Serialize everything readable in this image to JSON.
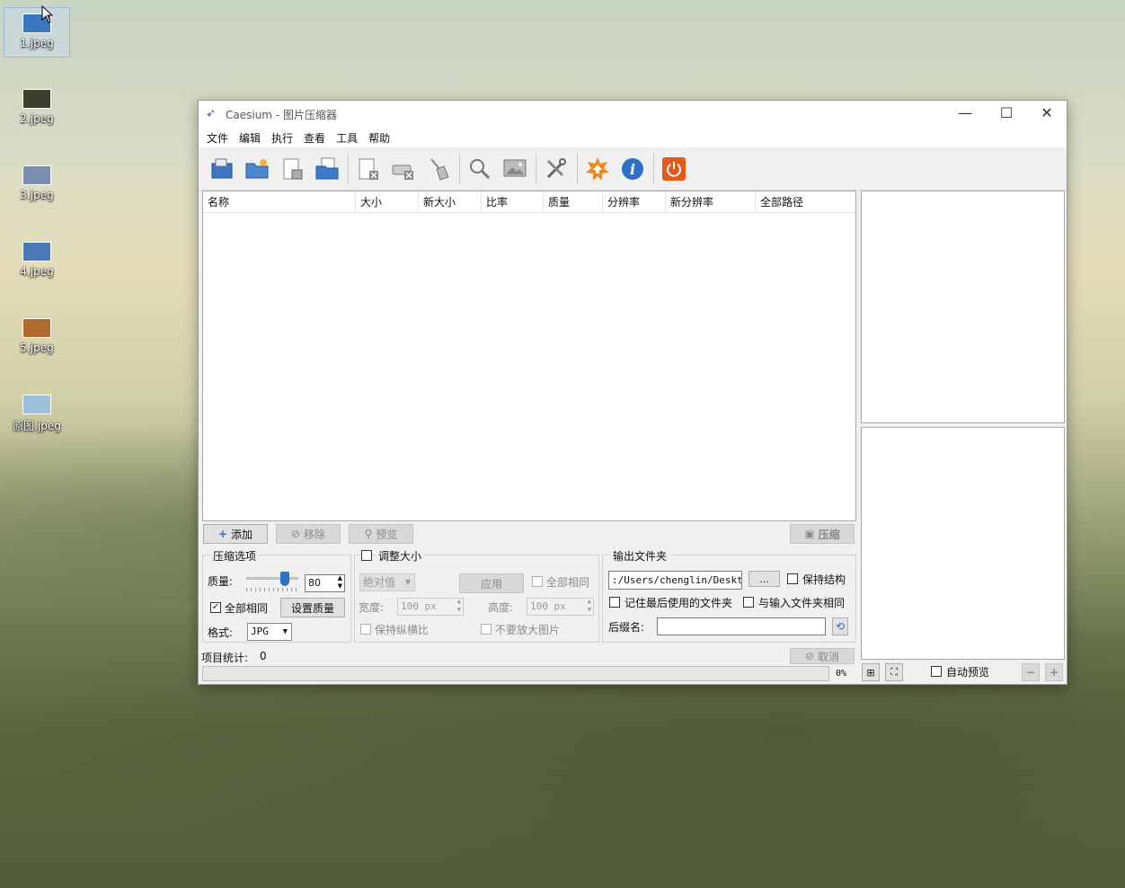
{
  "desktop": {
    "icons": [
      {
        "label": "1.jpeg",
        "color": "#3a78c0"
      },
      {
        "label": "2.jpeg",
        "color": "#3b3f2c"
      },
      {
        "label": "3.jpeg",
        "color": "#7a8fb0"
      },
      {
        "label": "4.jpeg",
        "color": "#4a78b8"
      },
      {
        "label": "5.jpeg",
        "color": "#b06a30"
      },
      {
        "label": "原图.jpeg",
        "color": "#9cc0dc"
      }
    ]
  },
  "window": {
    "title": "Caesium - 图片压缩器",
    "controls": {
      "minimize": "—",
      "maximize": "☐",
      "close": "✕"
    }
  },
  "menu": [
    "文件",
    "编辑",
    "执行",
    "查看",
    "工具",
    "帮助"
  ],
  "toolbar": {
    "icons": [
      "add-files-icon",
      "add-folder-icon",
      "save-list-icon",
      "open-list-icon",
      "remove-item-icon",
      "clear-drive-icon",
      "clean-broom-icon",
      "search-icon",
      "preview-image-icon",
      "settings-tools-icon",
      "update-star-icon",
      "info-icon",
      "power-icon"
    ]
  },
  "list": {
    "columns": [
      "名称",
      "大小",
      "新大小",
      "比率",
      "质量",
      "分辨率",
      "新分辨率",
      "全部路径"
    ]
  },
  "actions": {
    "add": "添加",
    "remove": "移除",
    "preview": "预览",
    "compress": "压缩"
  },
  "compression": {
    "title": "压缩选项",
    "quality_label": "质量:",
    "quality_value": "80",
    "quality_level": 80,
    "same_for_all": "全部相同",
    "set_quality": "设置质量",
    "format_label": "格式:",
    "format_value": "JPG"
  },
  "resize": {
    "title": "调整大小",
    "mode": "绝对值",
    "apply": "应用",
    "same_for_all": "全部相同",
    "width_label": "宽度:",
    "width_value": "100 px",
    "height_label": "高度:",
    "height_value": "100 px",
    "keep_ratio": "保持纵横比",
    "no_enlarge": "不要放大图片"
  },
  "output": {
    "title": "输出文件夹",
    "path": ":/Users/chenglin/Desktop",
    "browse": "...",
    "keep_structure": "保持结构",
    "remember_last": "记住最后使用的文件夹",
    "same_as_input": "与输入文件夹相同",
    "suffix_label": "后缀名:",
    "suffix_value": ""
  },
  "status": {
    "items_label": "项目统计:",
    "items_count": "0",
    "cancel": "取消",
    "progress_text": "0%",
    "progress": 0
  },
  "preview_bar": {
    "auto_preview": "自动预览"
  }
}
